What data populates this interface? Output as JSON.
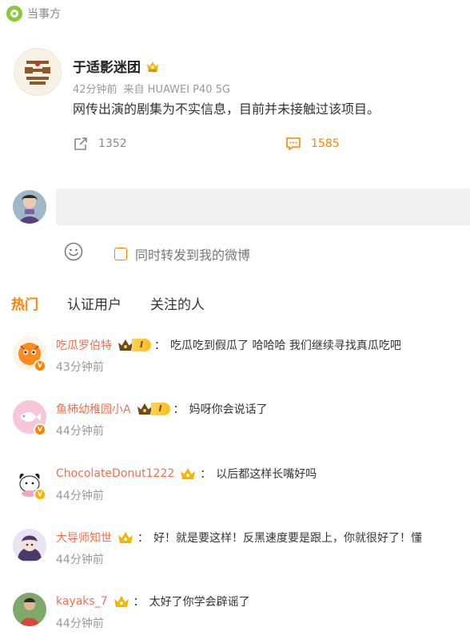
{
  "topbar": {
    "source": "当事方"
  },
  "post": {
    "author": "于适影迷团",
    "time": "42分钟前",
    "source": "来自 HUAWEI P40 5G",
    "text": "网传出演的剧集为不实信息，目前并未接触过该项目。",
    "reposts": "1352",
    "comments": "1585"
  },
  "composer": {
    "placeholder": "",
    "forward_label": "同时转发到我的微博"
  },
  "tabs": [
    {
      "label": "热门",
      "active": true
    },
    {
      "label": "认证用户",
      "active": false
    },
    {
      "label": "关注的人",
      "active": false
    }
  ],
  "comments": [
    {
      "name": "吃瓜罗伯特",
      "badge": "pill-I",
      "sep": "：",
      "text": "吃瓜吃到假瓜了 哈哈哈 我们继续寻找真瓜吃吧",
      "time": "43分钟前",
      "level_text": "I"
    },
    {
      "name": "鱼柿幼稚园小A",
      "badge": "pill-I",
      "sep": "：",
      "text": "妈呀你会说话了",
      "time": "44分钟前",
      "level_text": "I"
    },
    {
      "name": "ChocolateDonut1222",
      "badge": "crown",
      "sep": "：",
      "text": "以后都这样长嘴好吗",
      "time": "44分钟前"
    },
    {
      "name": "大导师知世",
      "badge": "crown",
      "sep": "：",
      "text": "好！就是要这样！反黑速度要是跟上，你就很好了！懂",
      "time": "44分钟前"
    },
    {
      "name": "kayaks_7",
      "badge": "crown",
      "sep": "：",
      "text": "太好了你学会辟谣了",
      "time": "44分钟前"
    }
  ],
  "colors": {
    "accent": "#ff8200",
    "name": "#eb7350",
    "meta": "#999999"
  }
}
